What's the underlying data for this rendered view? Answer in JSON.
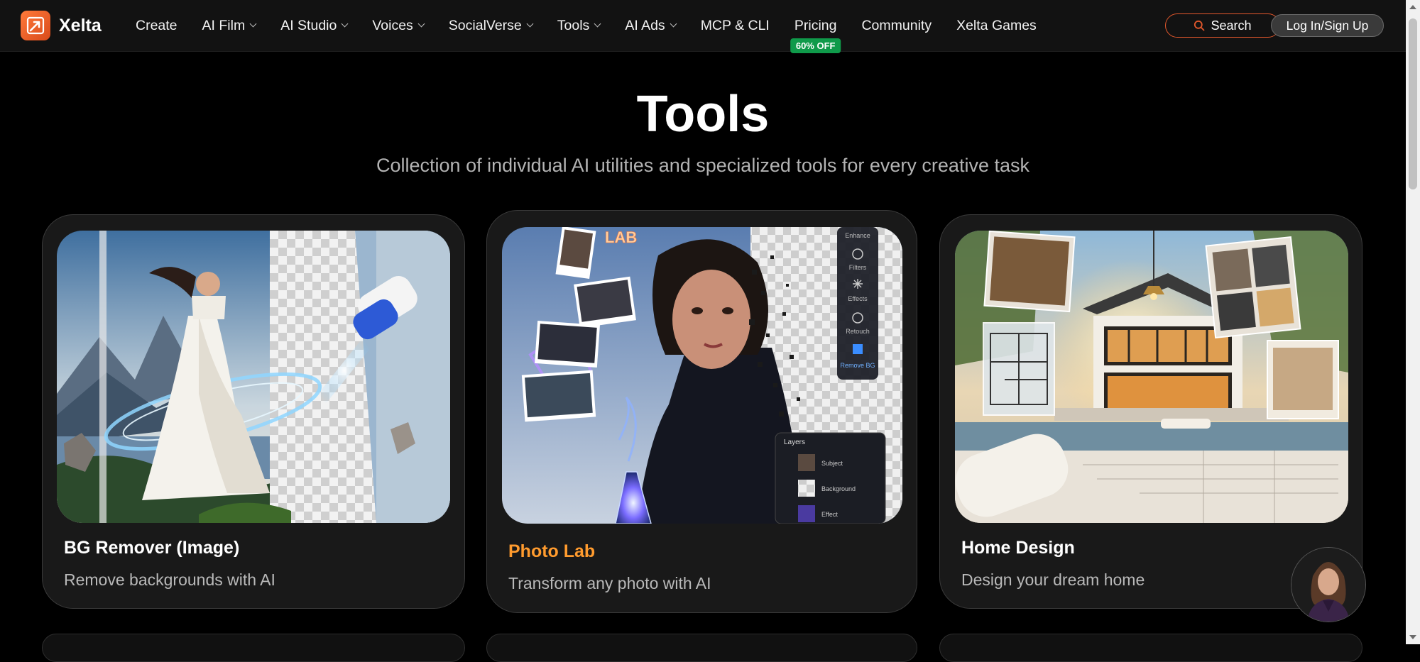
{
  "nav": {
    "brand": "Xelta",
    "items": [
      {
        "label": "Create",
        "dropdown": false
      },
      {
        "label": "AI Film",
        "dropdown": true
      },
      {
        "label": "AI Studio",
        "dropdown": true
      },
      {
        "label": "Voices",
        "dropdown": true
      },
      {
        "label": "SocialVerse",
        "dropdown": true
      },
      {
        "label": "Tools",
        "dropdown": true
      },
      {
        "label": "AI Ads",
        "dropdown": true
      },
      {
        "label": "MCP & CLI",
        "dropdown": false
      },
      {
        "label": "Pricing",
        "dropdown": false,
        "badge": "60% OFF"
      },
      {
        "label": "Community",
        "dropdown": false
      },
      {
        "label": "Xelta Games",
        "dropdown": false
      }
    ],
    "search_label": "Search",
    "login_label": "Log In/Sign Up"
  },
  "hero": {
    "title": "Tools",
    "subtitle": "Collection of individual AI utilities and specialized tools for every creative task"
  },
  "cards": [
    {
      "title": "BG Remover (Image)",
      "description": "Remove backgrounds with AI",
      "active": false
    },
    {
      "title": "Photo Lab",
      "description": "Transform any photo with AI",
      "active": true
    },
    {
      "title": "Home Design",
      "description": "Design your dream home",
      "active": false
    }
  ],
  "photo_lab_panel": {
    "tools": [
      "Enhance",
      "Filters",
      "Effects",
      "Retouch",
      "Remove BG"
    ],
    "layers_title": "Layers",
    "layers": [
      "Subject",
      "Background",
      "Effect"
    ],
    "lab_sign": "LAB"
  },
  "colors": {
    "accent_orange": "#ff9b2e",
    "search_border": "#e4582c",
    "badge_green": "#0f9a4a",
    "page_bg": "#000000",
    "card_bg": "#191919"
  },
  "icons": [
    "logo-icon",
    "search-icon",
    "chevron-down-icon",
    "assistant-avatar"
  ]
}
